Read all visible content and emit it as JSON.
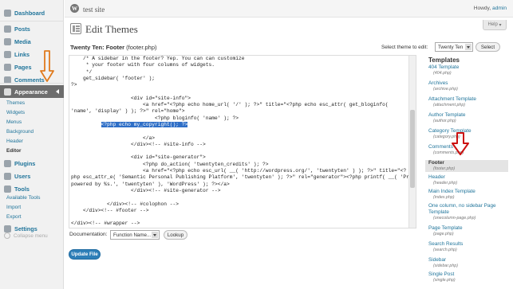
{
  "topbar": {
    "site_title": "test site",
    "howdy_prefix": "Howdy, ",
    "user": "admin"
  },
  "sidebar": {
    "items": [
      {
        "label": "Dashboard",
        "icon": "dashboard-icon"
      },
      {
        "label": "Posts",
        "icon": "pin-icon"
      },
      {
        "label": "Media",
        "icon": "media-icon"
      },
      {
        "label": "Links",
        "icon": "link-icon"
      },
      {
        "label": "Pages",
        "icon": "page-icon"
      },
      {
        "label": "Comments",
        "icon": "comment-icon"
      },
      {
        "label": "Appearance",
        "icon": "appearance-icon"
      },
      {
        "label": "Plugins",
        "icon": "plugin-icon"
      },
      {
        "label": "Users",
        "icon": "users-icon"
      },
      {
        "label": "Tools",
        "icon": "tools-icon"
      },
      {
        "label": "Settings",
        "icon": "settings-icon"
      }
    ],
    "appearance_sub": [
      "Themes",
      "Widgets",
      "Menus",
      "Background",
      "Header",
      "Editor"
    ],
    "tools_sub": [
      "Available Tools",
      "Import",
      "Export"
    ],
    "collapse_label": "Collapse menu"
  },
  "header": {
    "title": "Edit Themes",
    "help": "Help"
  },
  "file": {
    "title": "Twenty Ten: Footer",
    "filename": "(footer.php)"
  },
  "theme_select": {
    "label": "Select theme to edit:",
    "value": "Twenty Ten",
    "button": "Select"
  },
  "editor": {
    "lines": [
      "    /* A sidebar in the footer? Yep. You can can customize",
      "     * your footer with four columns of widgets.",
      "     */",
      "    get_sidebar( 'footer' );",
      "?>",
      "",
      "                    <div id=\"site-info\">",
      "                        <a href=\"<?php echo home_url( '/' ); ?>\" title=\"<?php echo esc_attr( get_bloginfo(",
      "'name', 'display' ) ); ?>\" rel=\"home\">",
      "                            <?php bloginfo( 'name' ); ?>",
      "",
      "                        </a>",
      "                    </div><!-- #site-info -->",
      "",
      "                    <div id=\"site-generator\">",
      "                        <?php do_action( 'twentyten_credits' ); ?>",
      "                        <a href=\"<?php echo esc_url( __( 'http://wordpress.org/', 'twentyten' ) ); ?>\" title=\"<?",
      "php esc_attr_e( 'Semantic Personal Publishing Platform', 'twentyten' ); ?>\" rel=\"generator\"><?php printf( __( 'Proudly",
      "powered by %s.', 'twentyten' ), 'WordPress' ); ?></a>",
      "                    </div><!-- #site-generator -->",
      "",
      "            </div><!-- #colophon -->",
      "    </div><!-- #footer -->",
      "",
      "</div><!-- #wrapper -->"
    ],
    "highlight": "<?php echo my_copyright(); ?>",
    "highlight_indent": "          "
  },
  "documentation": {
    "label": "Documentation:",
    "select_value": "Function Name...",
    "lookup": "Lookup"
  },
  "update_button": "Update File",
  "templates": {
    "heading": "Templates",
    "items": [
      {
        "name": "404 Template",
        "file": "(404.php)"
      },
      {
        "name": "Archives",
        "file": "(archive.php)"
      },
      {
        "name": "Attachment Template",
        "file": "(attachment.php)"
      },
      {
        "name": "Author Template",
        "file": "(author.php)"
      },
      {
        "name": "Category Template",
        "file": "(category.php)"
      },
      {
        "name": "Comments",
        "file": "(comments.php)"
      },
      {
        "name": "Footer",
        "file": "(footer.php)",
        "current": true
      },
      {
        "name": "Header",
        "file": "(header.php)"
      },
      {
        "name": "Main Index Template",
        "file": "(index.php)"
      },
      {
        "name": "One column, no sidebar Page Template",
        "file": "(onecolumn-page.php)"
      },
      {
        "name": "Page Template",
        "file": "(page.php)"
      },
      {
        "name": "Search Results",
        "file": "(search.php)"
      },
      {
        "name": "Sidebar",
        "file": "(sidebar.php)"
      },
      {
        "name": "Single Post",
        "file": "(single.php)"
      }
    ]
  },
  "colors": {
    "link": "#21759b",
    "active_menu": "#6d6d6d",
    "update_button": "#2e7fb8",
    "highlight": "#2f6fc7",
    "annotation_orange": "#e07b1e",
    "annotation_red": "#cc1111"
  }
}
